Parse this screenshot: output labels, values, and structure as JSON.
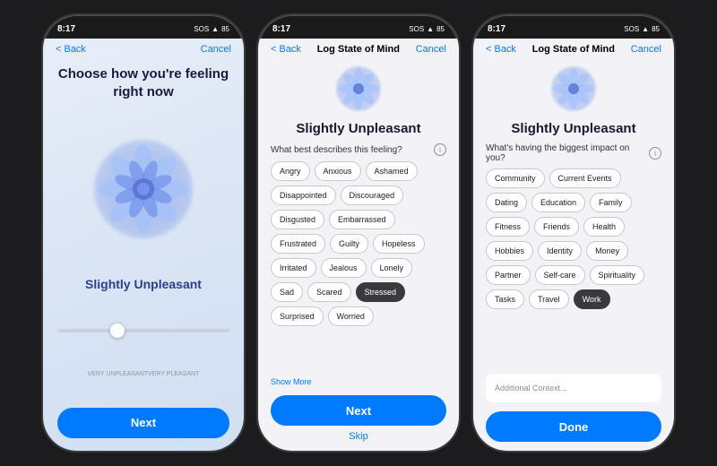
{
  "screen1": {
    "statusTime": "8:17",
    "statusExtra": "SOS ✦ 85",
    "navBack": "< Back",
    "navCancel": "Cancel",
    "mainTitle": "Choose how you're feeling\nright now",
    "feelingLabel": "Slightly Unpleasant",
    "sliderLabelLeft": "VERY UNPLEASANT",
    "sliderLabelRight": "VERY PLEASANT",
    "nextBtn": "Next"
  },
  "screen2": {
    "statusTime": "8:17",
    "statusExtra": "SOS ✦ 85",
    "navBack": "< Back",
    "navTitle": "Log State of Mind",
    "navCancel": "Cancel",
    "heading": "Slightly Unpleasant",
    "question": "What best describes this feeling?",
    "tags": [
      {
        "label": "Angry",
        "selected": false
      },
      {
        "label": "Anxious",
        "selected": false
      },
      {
        "label": "Ashamed",
        "selected": false
      },
      {
        "label": "Disappointed",
        "selected": false
      },
      {
        "label": "Discouraged",
        "selected": false
      },
      {
        "label": "Disgusted",
        "selected": false
      },
      {
        "label": "Embarrassed",
        "selected": false
      },
      {
        "label": "Frustrated",
        "selected": false
      },
      {
        "label": "Guilty",
        "selected": false
      },
      {
        "label": "Hopeless",
        "selected": false
      },
      {
        "label": "Irritated",
        "selected": false
      },
      {
        "label": "Jealous",
        "selected": false
      },
      {
        "label": "Lonely",
        "selected": false
      },
      {
        "label": "Sad",
        "selected": false
      },
      {
        "label": "Scared",
        "selected": false
      },
      {
        "label": "Stressed",
        "selected": true
      },
      {
        "label": "Surprised",
        "selected": false
      },
      {
        "label": "Worried",
        "selected": false
      }
    ],
    "showMore": "Show More",
    "nextBtn": "Next",
    "skipLink": "Skip"
  },
  "screen3": {
    "statusTime": "8:17",
    "statusExtra": "SOS ✦ 85",
    "navBack": "< Back",
    "navTitle": "Log State of Mind",
    "navCancel": "Cancel",
    "heading": "Slightly Unpleasant",
    "question": "What's having the biggest impact\non you?",
    "tags": [
      {
        "label": "Community",
        "selected": false
      },
      {
        "label": "Current Events",
        "selected": false
      },
      {
        "label": "Dating",
        "selected": false
      },
      {
        "label": "Education",
        "selected": false
      },
      {
        "label": "Family",
        "selected": false
      },
      {
        "label": "Fitness",
        "selected": false
      },
      {
        "label": "Friends",
        "selected": false
      },
      {
        "label": "Health",
        "selected": false
      },
      {
        "label": "Hobbies",
        "selected": false
      },
      {
        "label": "Identity",
        "selected": false
      },
      {
        "label": "Money",
        "selected": false
      },
      {
        "label": "Partner",
        "selected": false
      },
      {
        "label": "Self-care",
        "selected": false
      },
      {
        "label": "Spirituality",
        "selected": false
      },
      {
        "label": "Tasks",
        "selected": false
      },
      {
        "label": "Travel",
        "selected": false
      },
      {
        "label": "Work",
        "selected": true
      }
    ],
    "contextPlaceholder": "Additional Context...",
    "doneBtn": "Done"
  }
}
